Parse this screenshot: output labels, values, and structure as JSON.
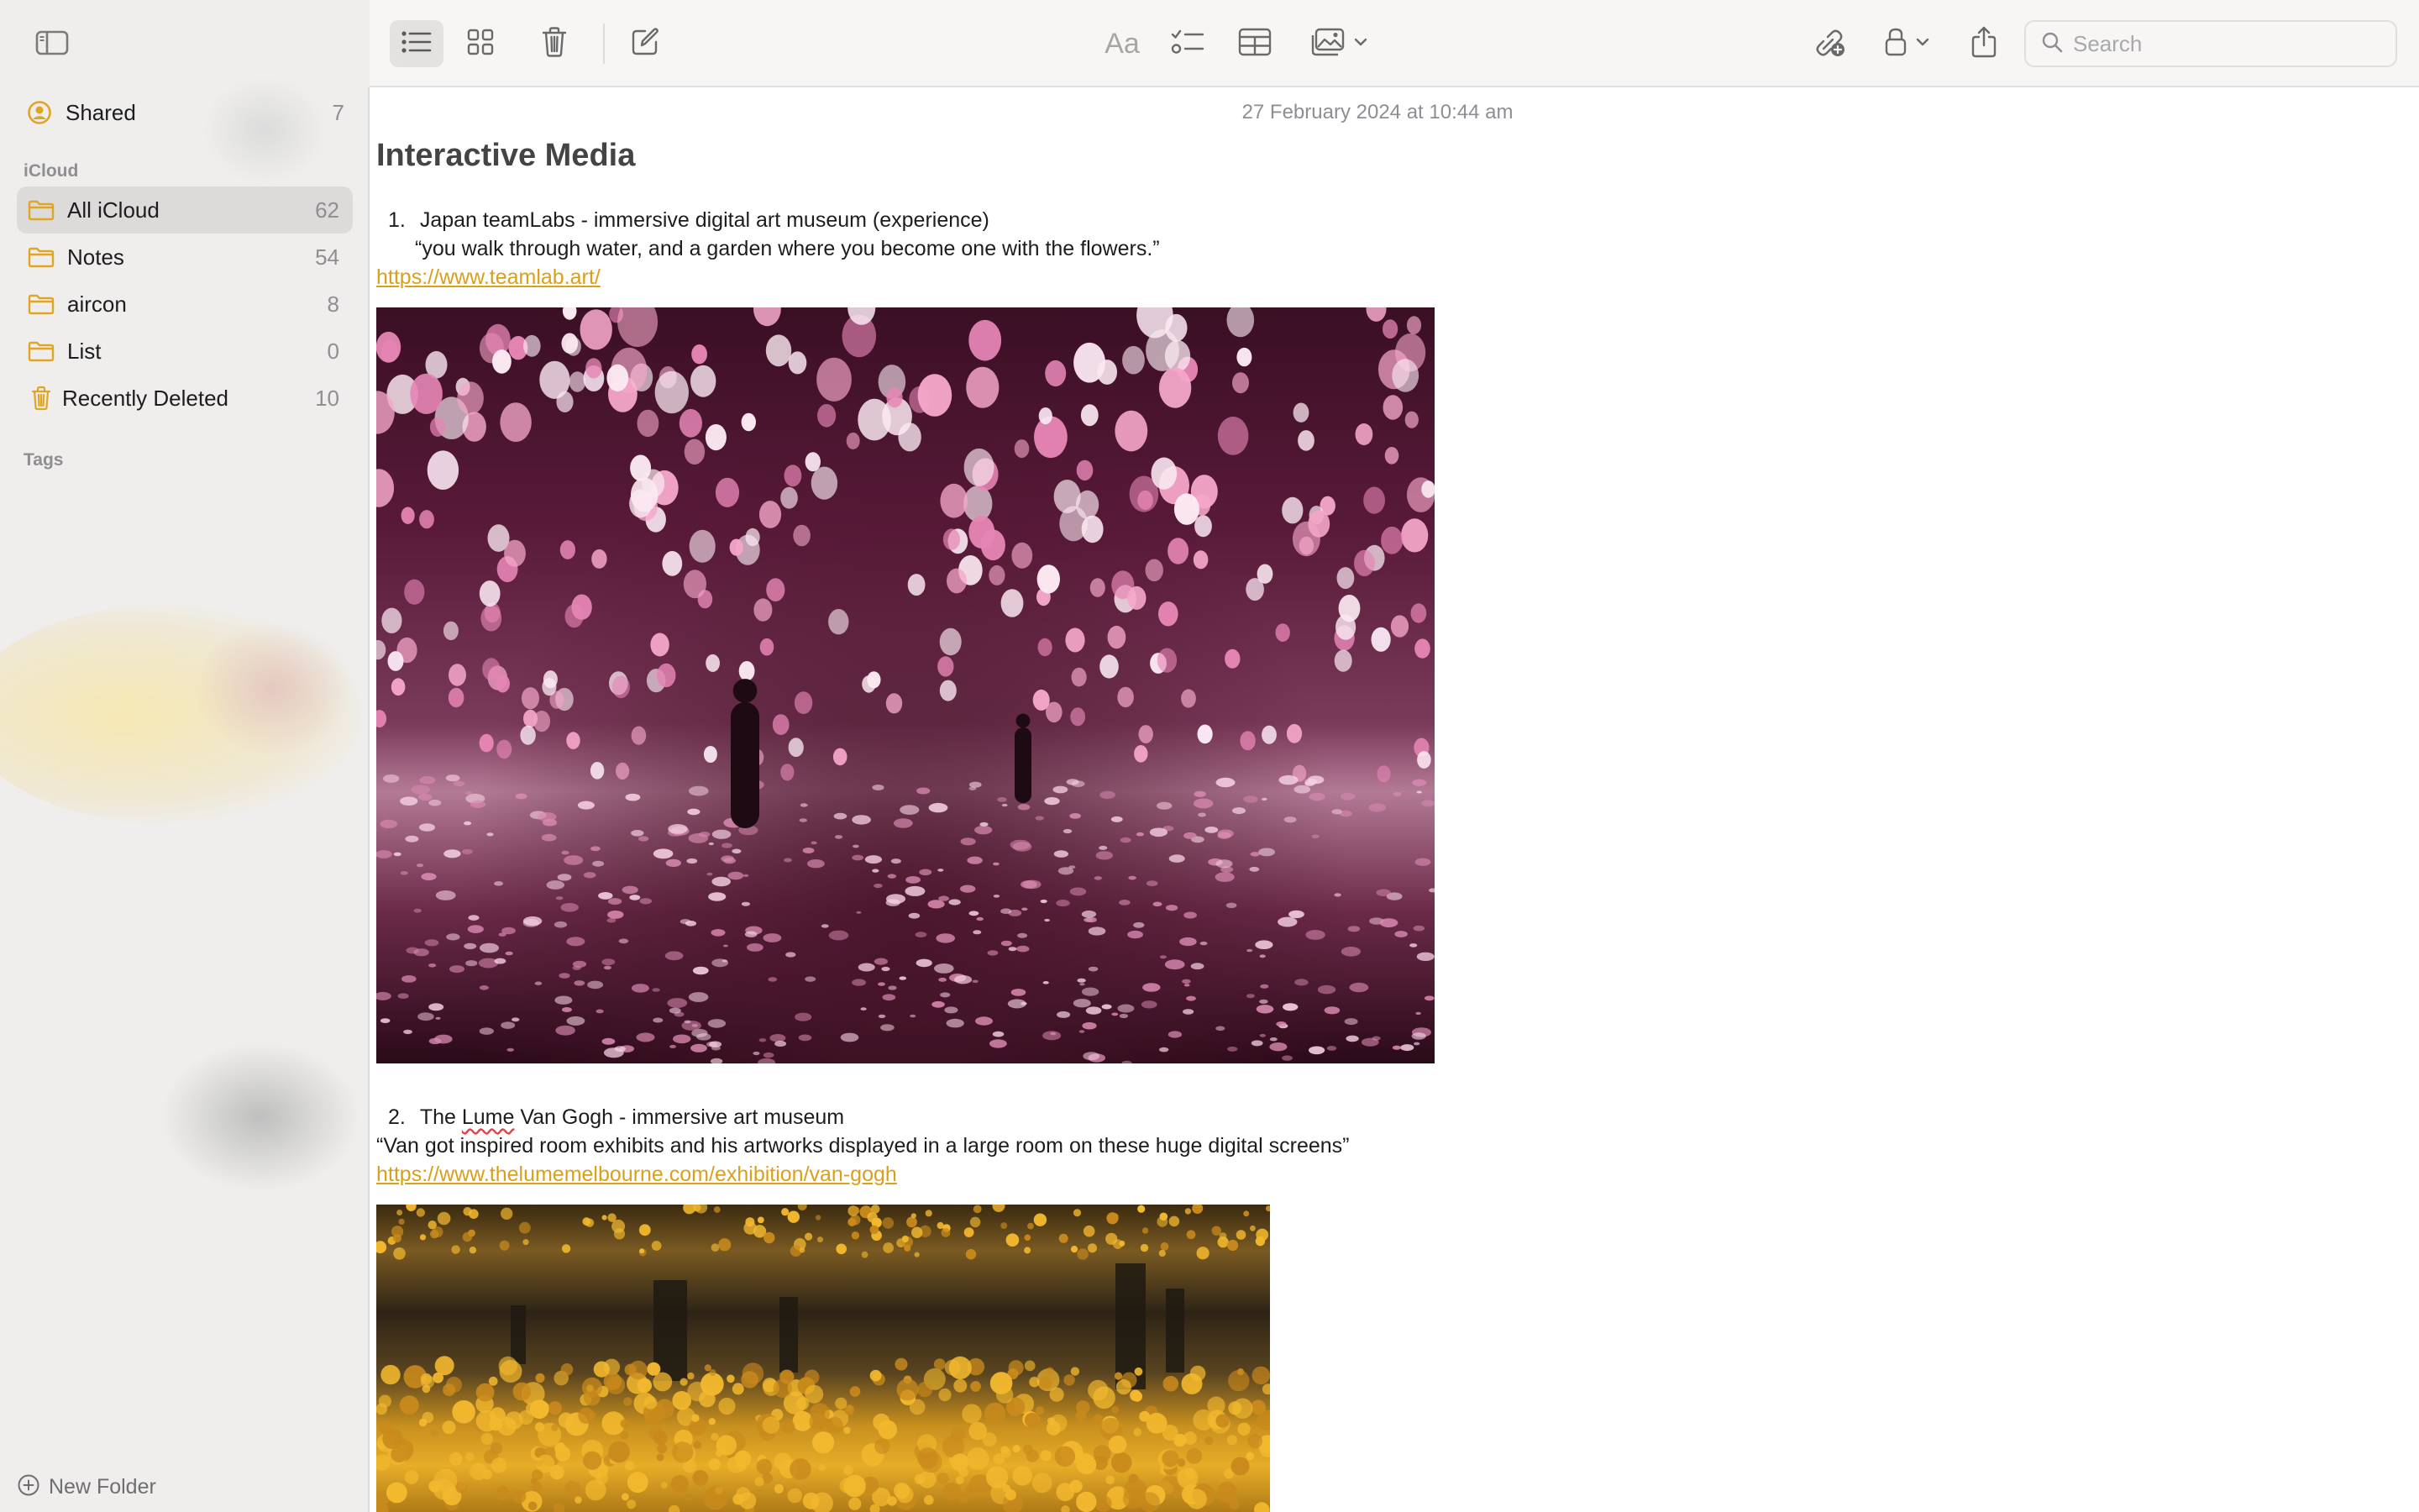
{
  "sidebar": {
    "shared": {
      "label": "Shared",
      "count": "7"
    },
    "icloud_section": "iCloud",
    "folders": [
      {
        "label": "All iCloud",
        "count": "62",
        "selected": true,
        "icon": "folder-icon"
      },
      {
        "label": "Notes",
        "count": "54",
        "selected": false,
        "icon": "folder-icon"
      },
      {
        "label": "aircon",
        "count": "8",
        "selected": false,
        "icon": "folder-icon"
      },
      {
        "label": "List",
        "count": "0",
        "selected": false,
        "icon": "folder-icon"
      },
      {
        "label": "Recently Deleted",
        "count": "10",
        "selected": false,
        "icon": "trash-icon"
      }
    ],
    "tags_section": "Tags",
    "new_folder_label": "New Folder"
  },
  "toolbar": {
    "format_label": "Aa",
    "search_placeholder": "Search"
  },
  "note": {
    "date": "27 February 2024 at 10:44 am",
    "title": "Interactive Media",
    "items": [
      {
        "number": "1.",
        "heading": "Japan teamLabs - immersive digital art museum (experience)",
        "quote": "“you walk through water, and a garden where you become one with the flowers.”",
        "link": "https://www.teamlab.art/"
      },
      {
        "number": "2.",
        "heading_before": "The ",
        "heading_misspelled": "Lume",
        "heading_after": " Van Gogh - immersive art museum",
        "quote": "“Van got inspired room exhibits and his artworks displayed in a large room on these huge digital screens”",
        "link": "https://www.thelumemelbourne.com/exhibition/van-gogh"
      }
    ]
  },
  "colors": {
    "accent": "#e2a521",
    "link": "#d9a019",
    "sidebar_bg": "#efeeec",
    "selected_row": "#dcdbd9"
  }
}
